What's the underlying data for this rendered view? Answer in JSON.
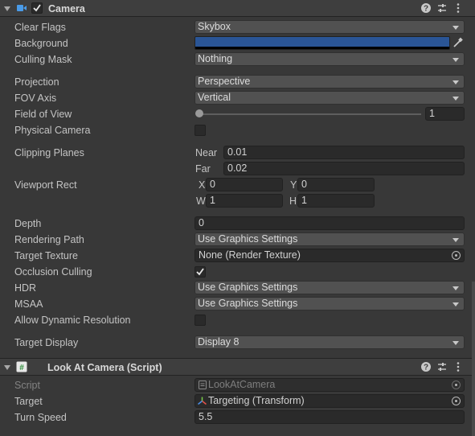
{
  "camera": {
    "title": "Camera",
    "enabled": true,
    "clear_flags": {
      "label": "Clear Flags",
      "value": "Skybox"
    },
    "background": {
      "label": "Background",
      "color": "#2a5596"
    },
    "culling_mask": {
      "label": "Culling Mask",
      "value": "Nothing"
    },
    "projection": {
      "label": "Projection",
      "value": "Perspective"
    },
    "fov_axis": {
      "label": "FOV Axis",
      "value": "Vertical"
    },
    "field_of_view": {
      "label": "Field of View",
      "value": "1",
      "slider_fraction": 0.0
    },
    "physical_camera": {
      "label": "Physical Camera",
      "checked": false
    },
    "clipping_planes": {
      "label": "Clipping Planes",
      "near_label": "Near",
      "near": "0.01",
      "far_label": "Far",
      "far": "0.02"
    },
    "viewport_rect": {
      "label": "Viewport Rect",
      "x_label": "X",
      "x": "0",
      "y_label": "Y",
      "y": "0",
      "w_label": "W",
      "w": "1",
      "h_label": "H",
      "h": "1"
    },
    "depth": {
      "label": "Depth",
      "value": "0"
    },
    "rendering_path": {
      "label": "Rendering Path",
      "value": "Use Graphics Settings"
    },
    "target_texture": {
      "label": "Target Texture",
      "value": "None (Render Texture)"
    },
    "occlusion_culling": {
      "label": "Occlusion Culling",
      "checked": true
    },
    "hdr": {
      "label": "HDR",
      "value": "Use Graphics Settings"
    },
    "msaa": {
      "label": "MSAA",
      "value": "Use Graphics Settings"
    },
    "allow_dynamic_resolution": {
      "label": "Allow Dynamic Resolution",
      "checked": false
    },
    "target_display": {
      "label": "Target Display",
      "value": "Display 8"
    }
  },
  "look_at_camera": {
    "title": "Look At Camera (Script)",
    "script": {
      "label": "Script",
      "value": "LookAtCamera"
    },
    "target": {
      "label": "Target",
      "value": "Targeting (Transform)"
    },
    "turn_speed": {
      "label": "Turn Speed",
      "value": "5.5"
    }
  },
  "icons": [
    "camera-icon",
    "help-icon",
    "presets-icon",
    "more-menu-icon",
    "script-icon",
    "eyedropper-icon",
    "object-picker-icon",
    "transform-icon",
    "checkmark-icon"
  ],
  "colors": {
    "panel": "#383838",
    "header": "#3e3e3e",
    "field": "#2a2a2a",
    "dropdown": "#515151",
    "accent_blue": "#3c8edb"
  }
}
